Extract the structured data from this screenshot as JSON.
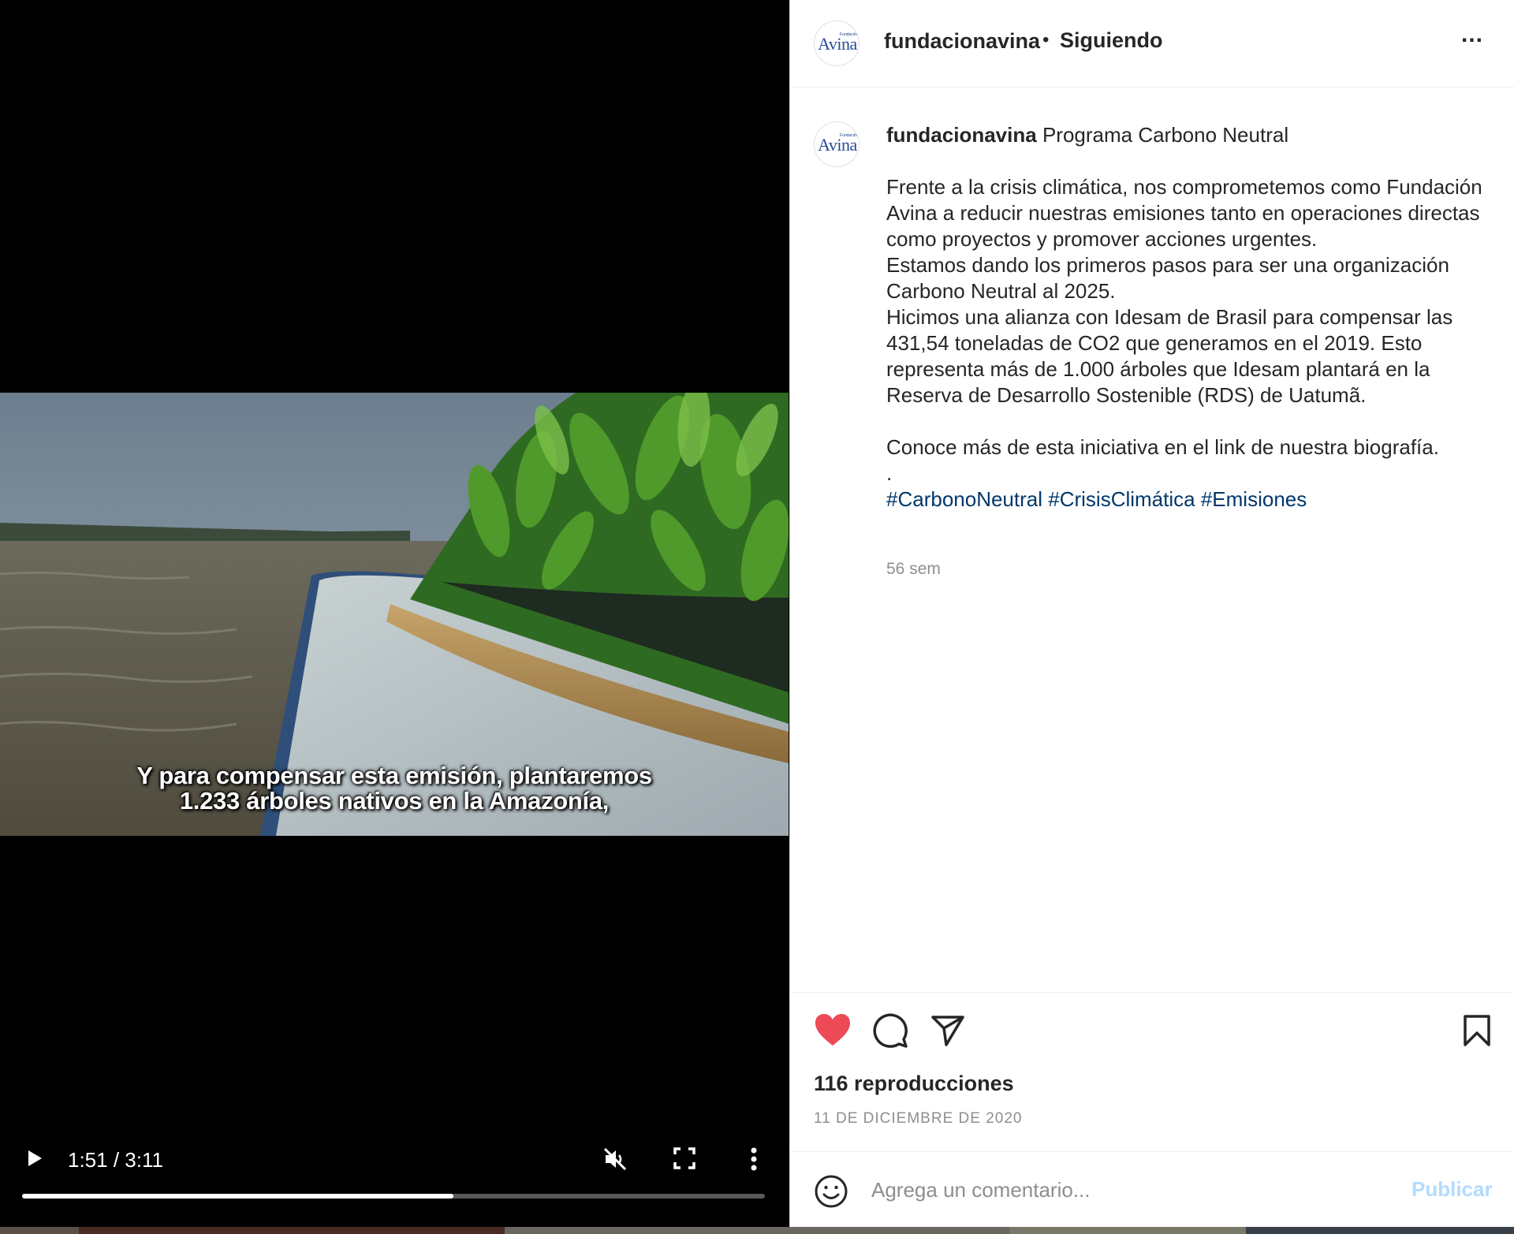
{
  "video": {
    "subtitle_line1": "Y para compensar esta emisión, plantaremos",
    "subtitle_line2": "1.233 árboles nativos en la Amazonía,",
    "time_display": "1:51 / 3:11",
    "progress_fraction": 0.581,
    "muted": true
  },
  "header": {
    "avatar_logo_small": "Fundación",
    "avatar_logo_main": "Avina",
    "username": "fundacionavina",
    "separator": "•",
    "follow_status": "Siguiendo",
    "more_label": "..."
  },
  "caption": {
    "username": "fundacionavina",
    "title": "Programa Carbono Neutral",
    "paragraph1": "Frente a la crisis climática, nos comprometemos como Fundación Avina a reducir nuestras emisiones tanto en operaciones directas como proyectos y promover acciones urgentes.",
    "paragraph2": "Estamos dando los primeros pasos para ser una organización Carbono Neutral al 2025.",
    "paragraph3": "Hicimos una alianza con Idesam de Brasil para compensar las 431,54 toneladas de CO2 que generamos en el 2019. Esto representa más de 1.000 árboles que Idesam plantará en la Reserva de Desarrollo Sostenible (RDS) de Uatumã.",
    "paragraph4": "Conoce más de esta iniciativa en el link de nuestra biografía.",
    "dot_line": ".",
    "hashtags": [
      "#CarbonoNeutral",
      "#CrisisClimática",
      "#Emisiones"
    ],
    "time_ago": "56 sem"
  },
  "actions": {
    "liked": true,
    "heart_color": "#ed4956",
    "views": "116 reproducciones",
    "date": "11 DE DICIEMBRE DE 2020"
  },
  "comment_box": {
    "placeholder": "Agrega un comentario...",
    "publish_label": "Publicar",
    "publish_color": "#b3dbff"
  }
}
